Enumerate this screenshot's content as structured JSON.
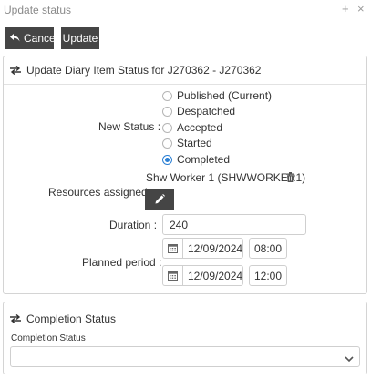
{
  "window": {
    "title": "Update status",
    "plus_glyph": "+",
    "close_glyph": "×"
  },
  "toolbar": {
    "cancel_label": "Cancel",
    "update_label": "Update"
  },
  "diary_panel": {
    "title": "Update Diary Item Status for J270362 - J270362",
    "new_status_label": "New Status :",
    "status_options": [
      {
        "label": "Published (Current)",
        "checked": false
      },
      {
        "label": "Despatched",
        "checked": false
      },
      {
        "label": "Accepted",
        "checked": false
      },
      {
        "label": "Started",
        "checked": false
      },
      {
        "label": "Completed",
        "checked": true
      }
    ],
    "resources_label": "Resources assigned :",
    "resource_name": "Shw Worker 1 (SHWWORKER1)",
    "duration_label": "Duration :",
    "duration_value": "240",
    "planned_label": "Planned period :",
    "start_date": "12/09/2024",
    "start_time": "08:00",
    "end_date": "12/09/2024",
    "end_time": "12:00"
  },
  "completion_panel": {
    "title": "Completion Status",
    "field_label": "Completion Status",
    "selected_value": ""
  },
  "colors": {
    "accent": "#2a7fd4",
    "dark_button": "#454545",
    "border": "#cfcfcf"
  }
}
